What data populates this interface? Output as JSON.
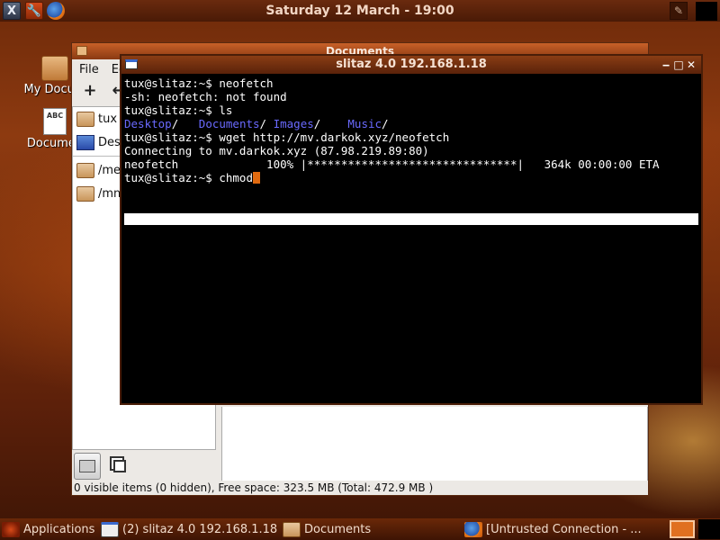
{
  "top_panel": {
    "clock": "Saturday 12 March - 19:00"
  },
  "desktop": {
    "icons": [
      {
        "label": "My Docum",
        "icon": "folder-icon"
      },
      {
        "label": "Documen",
        "icon": "text-document-icon",
        "glyph_text": "ABC"
      }
    ]
  },
  "documents_window": {
    "title": "Documents",
    "menu": [
      "File",
      "Ed"
    ],
    "sidebar": [
      {
        "label": "tux",
        "icon": "folder-icon"
      },
      {
        "label": "Desk",
        "icon": "desktop-icon"
      },
      {
        "label": "/med",
        "icon": "folder-icon"
      },
      {
        "label": "/mnt",
        "icon": "folder-icon"
      }
    ],
    "status": "0 visible items (0 hidden), Free space: 323.5 MB (Total: 472.9 MB )"
  },
  "terminal": {
    "title": "slitaz 4.0 192.168.1.18",
    "lines": [
      "tux@slitaz:~$ neofetch",
      "-sh: neofetch: not found",
      "tux@slitaz:~$ ls"
    ],
    "ls_output": {
      "dirs": [
        "Desktop",
        "Documents",
        "Images",
        "Music"
      ],
      "seps": [
        "/   ",
        "/ ",
        "/    ",
        "/"
      ]
    },
    "lines_after": [
      "tux@slitaz:~$ wget http://mv.darkok.xyz/neofetch",
      "Connecting to mv.darkok.xyz (87.98.219.89:80)",
      "neofetch             100% |*******************************|   364k 00:00:00 ETA"
    ],
    "current_input": "tux@slitaz:~$ chmod"
  },
  "taskbar": {
    "apps_label": "Applications",
    "tasks": [
      {
        "label": "(2) slitaz 4.0 192.168.1.18"
      },
      {
        "label": "Documents"
      },
      {
        "label": "[Untrusted Connection - ..."
      }
    ]
  }
}
